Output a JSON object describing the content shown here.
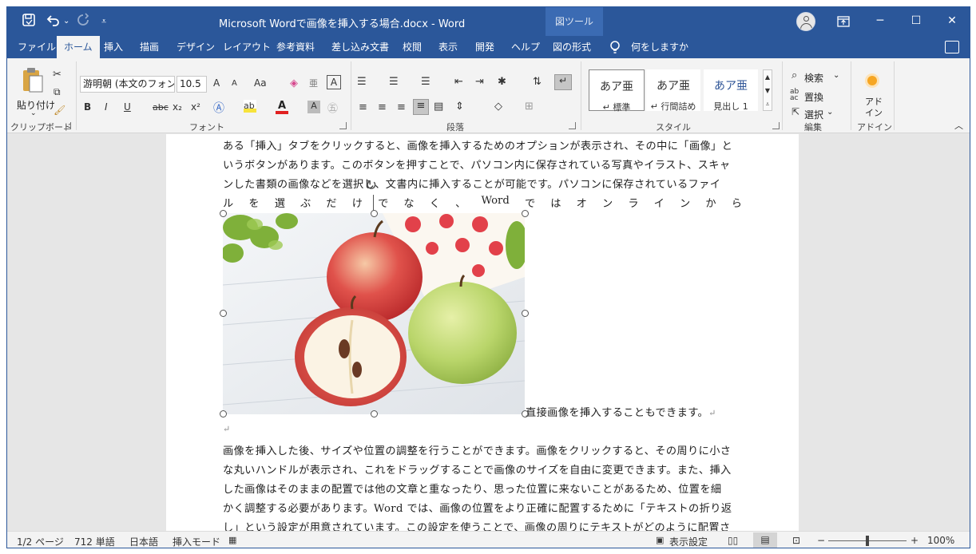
{
  "titlebar": {
    "title": "Microsoft Wordで画像を挿入する場合.docx  -  Word",
    "context_tab_group": "図ツール",
    "autosave_icon": "autosave-icon",
    "undo_icon": "undo-icon",
    "redo_icon": "redo-icon",
    "minimize": "─",
    "restore": "☐",
    "close": "✕"
  },
  "tabs": [
    "ファイル",
    "ホーム",
    "挿入",
    "描画",
    "デザイン",
    "レイアウト",
    "参考資料",
    "差し込み文書",
    "校閲",
    "表示",
    "開発",
    "ヘルプ",
    "図の形式"
  ],
  "active_tab": "ホーム",
  "tell_me": "何をしますか",
  "ribbon": {
    "clipboard": {
      "paste_label": "貼り付け",
      "group_label": "クリップボード"
    },
    "font": {
      "font_name": "游明朝 (本文のフォン",
      "font_size": "10.5",
      "group_label": "フォント",
      "grow": "A",
      "shrink": "A",
      "case": "Aa",
      "bold": "B",
      "italic": "I",
      "underline": "U",
      "strike": "abc",
      "subscript": "x₂",
      "superscript": "x²"
    },
    "paragraph": {
      "group_label": "段落"
    },
    "styles": {
      "group_label": "スタイル",
      "items": [
        {
          "preview": "あア亜",
          "name": "↵ 標準"
        },
        {
          "preview": "あア亜",
          "name": "↵ 行間詰め"
        },
        {
          "preview": "あア亜",
          "name": "見出し 1"
        }
      ]
    },
    "editing": {
      "find": "検索",
      "replace": "置換",
      "select": "選択",
      "group_label": "編集"
    },
    "addins": {
      "label": "アド\nイン",
      "group_label": "アドイン"
    }
  },
  "document": {
    "lines_before": [
      "ある「挿入」タブをクリックすると、画像を挿入するためのオプションが表示され、その中に「画像」と",
      "いうボタンがあります。このボタンを押すことで、パソコン内に保存されている写真やイラスト、スキャ",
      "ンした書類の画像などを選択し、文書内に挿入することが可能です。パソコンに保存されているファイ"
    ],
    "spread_line": [
      "ル",
      "を",
      "選",
      "ぶ",
      "だ",
      "け",
      "で",
      "な",
      "く",
      "、",
      "Word",
      "で",
      "は",
      "オ",
      "ン",
      "ラ",
      "イ",
      "ン",
      "か",
      "ら"
    ],
    "after_image_text": "直接画像を挿入することもできます。",
    "paragraph_mark": "↵",
    "lines_after": [
      "画像を挿入した後、サイズや位置の調整を行うことができます。画像をクリックすると、その周りに小さ",
      "な丸いハンドルが表示され、これをドラッグすることで画像のサイズを自由に変更できます。また、挿入",
      "した画像はそのままの配置では他の文章と重なったり、思った位置に来ないことがあるため、位置を細",
      "かく調整する必要があります。Word では、画像の位置をより正確に配置するために「テキストの折り返",
      "し」という設定が用意されています。この設定を使うことで、画像の周りにテキストがどのように配置さ"
    ]
  },
  "statusbar": {
    "page": "1/2 ページ",
    "words": "712 単語",
    "language": "日本語",
    "mode": "挿入モード",
    "display_settings": "表示設定",
    "zoom": "100%",
    "zoom_minus": "−",
    "zoom_plus": "+"
  }
}
